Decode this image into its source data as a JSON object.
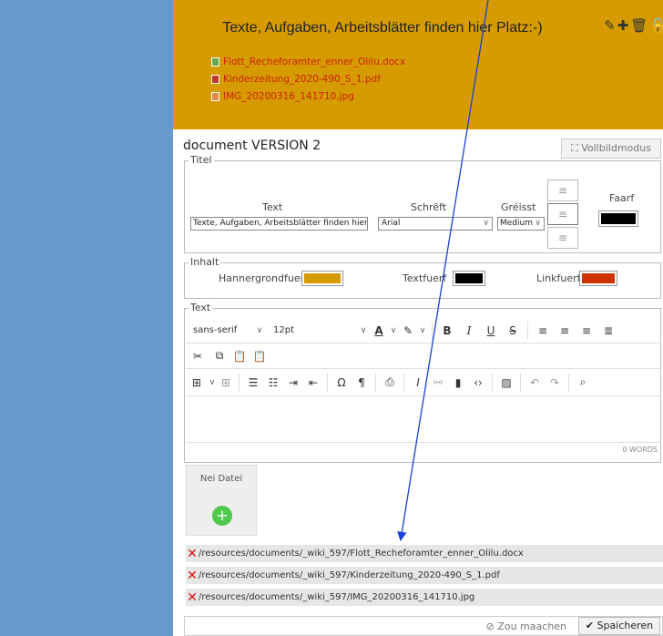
{
  "section": {
    "title": "Texte, Aufgaben, Arbeitsblätter finden hier Platz:-)",
    "files": [
      {
        "name": "Flott_Recheforamter_enner_Olilu.docx",
        "type": "docx"
      },
      {
        "name": "Kinderzeitung_2020-490_S_1.pdf",
        "type": "pdf"
      },
      {
        "name": "IMG_20200316_141710.jpg",
        "type": "jpg"
      }
    ]
  },
  "dialog": {
    "title": "document VERSION 2",
    "fullscreen_label": "⛶ Vollbildmodus",
    "titel": {
      "legend": "Titel",
      "text_label": "Text",
      "text_value": "Texte, Aufgaben, Arbeitsblätter finden hier Platz:-)",
      "font_label": "Schrëft",
      "font_value": "Arial",
      "size_label": "Gréisst",
      "size_value": "Medium",
      "color_label": "Faarf",
      "color": "#000000"
    },
    "inhalt": {
      "legend": "Inhalt",
      "bg_label": "Hannergrondfuerf",
      "bg_color": "#d59b00",
      "text_label": "Textfuerf",
      "text_color": "#000000",
      "link_label": "Linkfuerf",
      "link_color": "#cc3300"
    },
    "text": {
      "legend": "Text",
      "font_family": "sans-serif",
      "font_size": "12pt",
      "word_count": "0 WORDS"
    },
    "newfile_label": "Nei Datei",
    "resources": [
      "/resources/documents/_wiki_597/Flott_Recheforamter_enner_Olilu.docx",
      "/resources/documents/_wiki_597/Kinderzeitung_2020-490_S_1.pdf",
      "/resources/documents/_wiki_597/IMG_20200316_141710.jpg"
    ],
    "undo_label": "⊘ Zou maachen",
    "save_label": "✔ Spaicheren"
  }
}
